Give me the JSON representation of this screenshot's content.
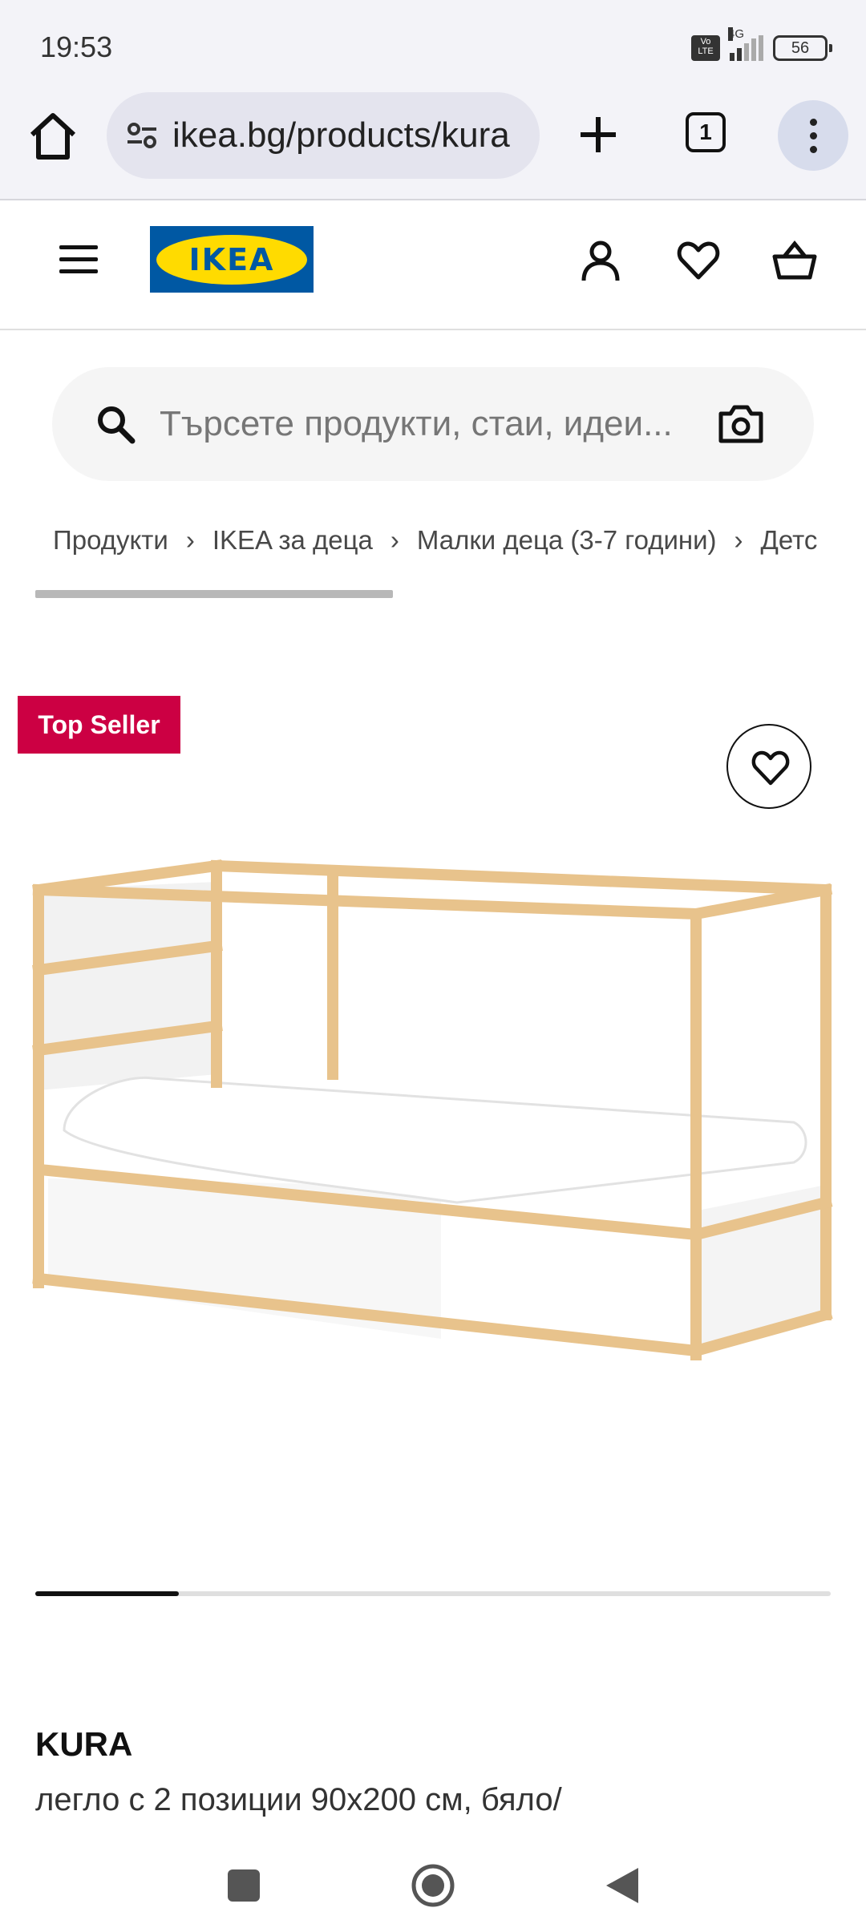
{
  "status_bar": {
    "time": "19:53",
    "volte": "Vo LTE",
    "network": "4G",
    "battery": "56"
  },
  "browser": {
    "url": "ikea.bg/products/kura",
    "tab_count": "1"
  },
  "site": {
    "logo_text": "IKEA",
    "brand_blue": "#0058a3",
    "brand_yellow": "#ffdb00"
  },
  "search": {
    "placeholder": "Търсете продукти, стаи, идеи..."
  },
  "breadcrumb": {
    "items": [
      "Продукти",
      "IKEA за деца",
      "Малки деца (3-7 години)",
      "Детс"
    ],
    "separator": "›"
  },
  "product": {
    "badge": "Top Seller",
    "badge_color": "#cc0043",
    "name": "KURA",
    "description": "легло с 2 позиции 90x200 см, бяло/",
    "image_progress": 0.18
  },
  "icons": {
    "home": "home-icon",
    "site_settings": "site-settings-icon",
    "new_tab": "plus-icon",
    "menu": "more-vert-icon",
    "hamburger": "hamburger-menu-icon",
    "account": "user-icon",
    "favourites": "heart-icon",
    "cart": "shopping-basket-icon",
    "search": "search-icon",
    "camera": "camera-icon"
  }
}
